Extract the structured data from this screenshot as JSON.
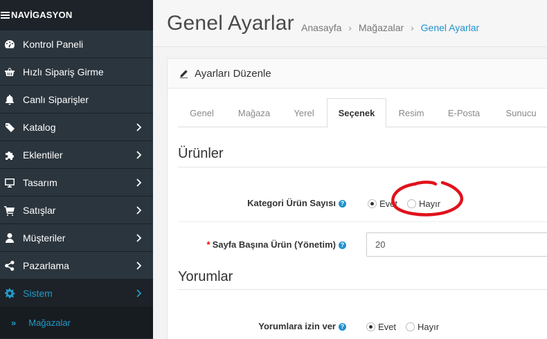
{
  "sidebar": {
    "header": "NAVİGASYON",
    "items": [
      {
        "label": "Kontrol Paneli",
        "icon": "dashboard-icon",
        "has_children": false
      },
      {
        "label": "Hızlı Sipariş Girme",
        "icon": "basket-icon",
        "has_children": false
      },
      {
        "label": "Canlı Siparişler",
        "icon": "bell-icon",
        "has_children": false
      },
      {
        "label": "Katalog",
        "icon": "tag-icon",
        "has_children": true
      },
      {
        "label": "Eklentiler",
        "icon": "puzzle-icon",
        "has_children": true
      },
      {
        "label": "Tasarım",
        "icon": "monitor-icon",
        "has_children": true
      },
      {
        "label": "Satışlar",
        "icon": "cart-icon",
        "has_children": true
      },
      {
        "label": "Müşteriler",
        "icon": "user-icon",
        "has_children": true
      },
      {
        "label": "Pazarlama",
        "icon": "share-icon",
        "has_children": true
      },
      {
        "label": "Sistem",
        "icon": "gear-icon",
        "has_children": true
      }
    ],
    "subitem": {
      "arrows": "»",
      "label": "Mağazalar"
    }
  },
  "header": {
    "title": "Genel Ayarlar",
    "breadcrumb": [
      "Anasayfa",
      "Mağazalar",
      "Genel Ayarlar"
    ],
    "breadcrumb_sep": "›"
  },
  "panel": {
    "heading": "Ayarları Düzenle",
    "tabs": [
      "Genel",
      "Mağaza",
      "Yerel",
      "Seçenek",
      "Resim",
      "E-Posta",
      "Sunucu"
    ],
    "active_tab": "Seçenek",
    "sections": {
      "products": {
        "legend": "Ürünler",
        "category_count_label": "Kategori Ürün Sayısı",
        "category_count_options": [
          "Evet",
          "Hayır"
        ],
        "category_count_selected": "Evet",
        "per_page_label": "Sayfa Başına Ürün (Yönetim)",
        "per_page_value": "20"
      },
      "reviews": {
        "legend": "Yorumlar",
        "allow_label": "Yorumlara izin ver",
        "allow_options": [
          "Evet",
          "Hayır"
        ],
        "allow_selected": "Evet"
      }
    },
    "required_mark": "*",
    "help_mark": "?"
  },
  "colors": {
    "sidebar_bg": "#2b353d",
    "active_accent": "#229ac8",
    "link_blue": "#1e91cf",
    "annotation_red": "#e0121b"
  }
}
